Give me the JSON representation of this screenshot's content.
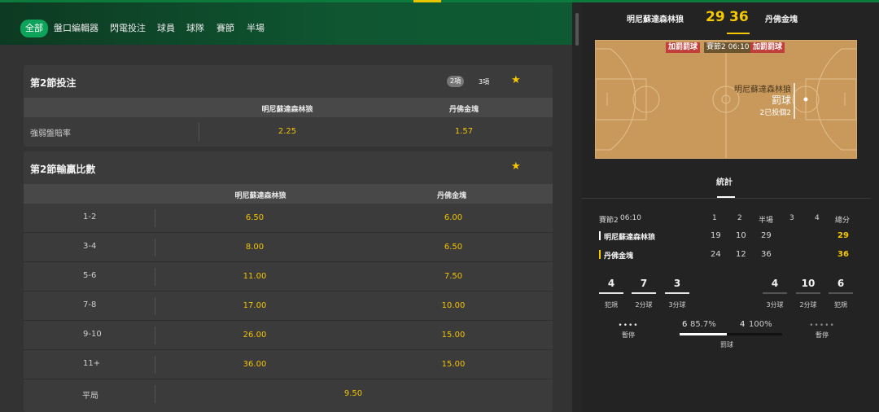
{
  "nav": {
    "tabs": [
      "全部",
      "盤口編輯器",
      "閃電投注",
      "球員",
      "球隊",
      "賽節",
      "半場"
    ],
    "active": "全部"
  },
  "card1": {
    "title": "第2節投注",
    "pills": [
      "2項",
      "3項"
    ],
    "headers": [
      "明尼蘇達森林狼",
      "丹佛金塊"
    ],
    "row": {
      "label": "強弱盤賠率",
      "odds": [
        "2.25",
        "1.57"
      ]
    }
  },
  "card2": {
    "title": "第2節輸贏比數",
    "headers": [
      "明尼蘇達森林狼",
      "丹佛金塊"
    ],
    "rows": [
      {
        "label": "1-2",
        "odds": [
          "6.50",
          "6.00"
        ]
      },
      {
        "label": "3-4",
        "odds": [
          "8.00",
          "6.50"
        ]
      },
      {
        "label": "5-6",
        "odds": [
          "11.00",
          "7.50"
        ]
      },
      {
        "label": "7-8",
        "odds": [
          "17.00",
          "10.00"
        ]
      },
      {
        "label": "9-10",
        "odds": [
          "26.00",
          "15.00"
        ]
      },
      {
        "label": "11+",
        "odds": [
          "36.00",
          "15.00"
        ]
      }
    ],
    "draw": {
      "label": "平局",
      "odd": "9.50"
    }
  },
  "scoreboard": {
    "home": "明尼蘇達森林狼",
    "away": "丹佛金塊",
    "home_score": "29",
    "away_score": "36"
  },
  "court": {
    "badge_left": "加罰罰球",
    "clock": "賽節2 06:10",
    "badge_right": "加罰罰球",
    "team": "明尼蘇達森林狼",
    "event": "罰球",
    "detail": "2已投個2"
  },
  "stats": {
    "tab": "統計",
    "period_label": "賽節2",
    "clock": "06:10",
    "columns": [
      "1",
      "2",
      "半場",
      "3",
      "4",
      "總分"
    ],
    "teams": [
      {
        "name": "明尼蘇達森林狼",
        "q1": "19",
        "q2": "10",
        "half": "29",
        "q3": "",
        "q4": "",
        "total": "29",
        "color": "#ffffff"
      },
      {
        "name": "丹佛金塊",
        "q1": "24",
        "q2": "12",
        "half": "36",
        "q3": "",
        "q4": "",
        "total": "36",
        "color": "#f5c800"
      }
    ],
    "home_box": [
      {
        "value": "4",
        "label": "犯規"
      },
      {
        "value": "7",
        "label": "2分球"
      },
      {
        "value": "3",
        "label": "3分球"
      }
    ],
    "away_box": [
      {
        "value": "4",
        "label": "3分球"
      },
      {
        "value": "10",
        "label": "2分球"
      },
      {
        "value": "6",
        "label": "犯規"
      }
    ],
    "timeout_label": "暫停",
    "free_throw": {
      "label": "罰球",
      "home_count": "6",
      "home_pct": "85.7%",
      "home_ratio": 0.857,
      "away_count": "4",
      "away_pct": "100%",
      "away_ratio": 1.0
    }
  },
  "colors": {
    "accent": "#f5c800",
    "brand": "#0ea35a"
  }
}
